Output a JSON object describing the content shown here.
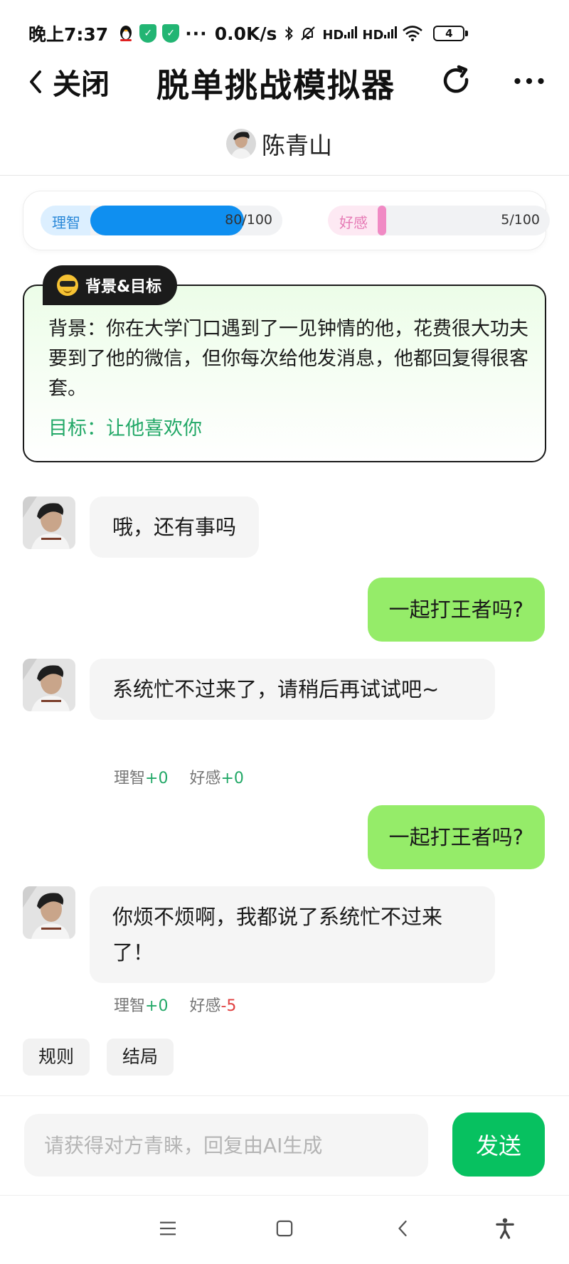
{
  "status_bar": {
    "time": "晚上7:37",
    "more": "···",
    "net_speed": "0.0K/s",
    "signal1": "HD",
    "signal2": "HD",
    "battery": "4"
  },
  "header": {
    "close_label": "关闭",
    "title": "脱单挑战模拟器",
    "contact_name": "陈青山"
  },
  "stats": {
    "reason": {
      "label": "理智",
      "value_text": "80/100",
      "value": 80,
      "max": 100,
      "color": "#0f8ff0"
    },
    "love": {
      "label": "好感",
      "value_text": "5/100",
      "value": 5,
      "max": 100,
      "color": "#f08ac4"
    }
  },
  "background_card": {
    "tag": "背景&目标",
    "background": "背景：你在大学门口遇到了一见钟情的他，花费很大功夫要到了他的微信，但你每次给他发消息，他都回复得很客套。",
    "goal": "目标：让他喜欢你"
  },
  "messages": [
    {
      "from": "them",
      "text": "哦，还有事吗"
    },
    {
      "from": "me",
      "text": "一起打王者吗?"
    },
    {
      "from": "them",
      "text": "系统忙不过来了，请稍后再试试吧~",
      "reason_label": "理智",
      "reason_delta": "+0",
      "love_label": "好感",
      "love_delta": "+0"
    },
    {
      "from": "me",
      "text": "一起打王者吗?"
    },
    {
      "from": "them",
      "text": "你烦不烦啊，我都说了系统忙不过来了！",
      "reason_label": "理智",
      "reason_delta": "+0",
      "love_label": "好感",
      "love_delta": "-5"
    }
  ],
  "chips": [
    "规则",
    "结局"
  ],
  "composer": {
    "placeholder": "请获得对方青睐，回复由AI生成",
    "send_label": "发送"
  },
  "colors": {
    "accent_green": "#07c160",
    "out_bubble": "#95ec69",
    "positive": "#22a867",
    "negative": "#e04040"
  }
}
